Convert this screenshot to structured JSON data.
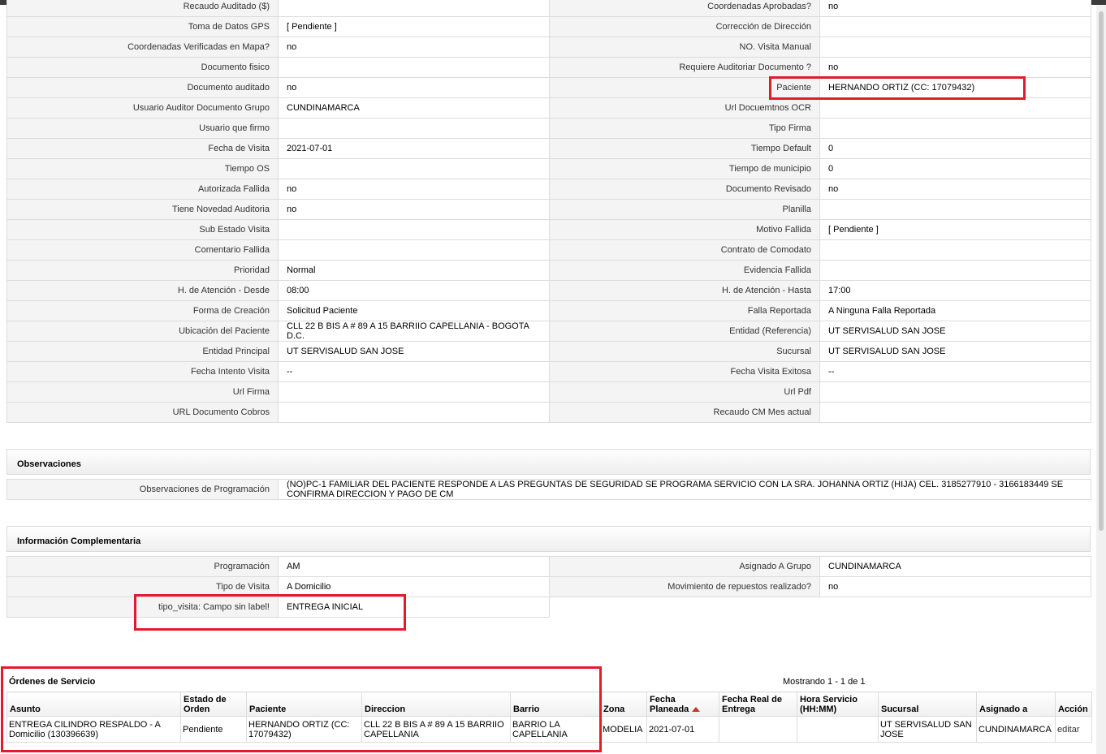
{
  "main_fields": [
    [
      "Recaudo Auditado ($)",
      "",
      "Coordenadas Aprobadas?",
      "no"
    ],
    [
      "Toma de Datos GPS",
      "[ Pendiente ]",
      "Corrección de Dirección",
      ""
    ],
    [
      "Coordenadas Verificadas en Mapa?",
      "no",
      "NO. Visita Manual",
      ""
    ],
    [
      "Documento fisico",
      "",
      "Requiere Auditoriar Documento ?",
      "no"
    ],
    [
      "Documento auditado",
      "no",
      "Paciente",
      "HERNANDO ORTIZ (CC: 17079432)"
    ],
    [
      "Usuario Auditor Documento Grupo",
      "CUNDINAMARCA",
      "Url Docuemtnos OCR",
      ""
    ],
    [
      "Usuario que firmo",
      "",
      "Tipo Firma",
      ""
    ],
    [
      "Fecha de Visita",
      "2021-07-01",
      "Tiempo Default",
      "0"
    ],
    [
      "Tiempo OS",
      "",
      "Tiempo de municipio",
      "0"
    ],
    [
      "Autorizada Fallida",
      "no",
      "Documento Revisado",
      "no"
    ],
    [
      "Tiene Novedad Auditoria",
      "no",
      "Planilla",
      ""
    ],
    [
      "Sub Estado Visita",
      "",
      "Motivo Fallida",
      "[ Pendiente ]"
    ],
    [
      "Comentario Fallida",
      "",
      "Contrato de Comodato",
      ""
    ],
    [
      "Prioridad",
      "Normal",
      "Evidencia Fallida",
      ""
    ],
    [
      "H. de Atención - Desde",
      "08:00",
      "H. de Atención - Hasta",
      "17:00"
    ],
    [
      "Forma de Creación",
      "Solicitud Paciente",
      "Falla Reportada",
      "A Ninguna Falla Reportada"
    ],
    [
      "Ubicación del Paciente",
      "CLL 22 B BIS A # 89 A 15 BARRIIO CAPELLANIA - BOGOTA D.C.",
      "Entidad (Referencia)",
      "UT SERVISALUD SAN JOSE"
    ],
    [
      "Entidad Principal",
      "UT SERVISALUD SAN JOSE",
      "Sucursal",
      "UT SERVISALUD SAN JOSE"
    ],
    [
      "Fecha Intento Visita",
      "--",
      "Fecha Visita Exitosa",
      "--"
    ],
    [
      "Url Firma",
      "",
      "Url Pdf",
      ""
    ],
    [
      "URL Documento Cobros",
      "",
      "Recaudo CM Mes actual",
      ""
    ]
  ],
  "observaciones": {
    "title": "Observaciones",
    "label": "Observaciones de Programación",
    "value": "(NO)PC-1 FAMILIAR DEL PACIENTE RESPONDE A LAS PREGUNTAS DE SEGURIDAD SE PROGRAMA SERVICIO CON LA SRA. JOHANNA ORTIZ (HIJA) CEL. 3185277910 - 3166183449 SE CONFIRMA DIRECCION Y PAGO DE CM"
  },
  "complementaria": {
    "title": "Información Complementaria",
    "rows": [
      [
        "Programación",
        "AM",
        "Asignado A Grupo",
        "CUNDINAMARCA"
      ],
      [
        "Tipo de Visita",
        "A Domicilio",
        "Movimiento de repuestos realizado?",
        "no"
      ]
    ],
    "extra": {
      "label": "tipo_visita: Campo sin label!",
      "value": "ENTREGA INICIAL"
    }
  },
  "ordenes": {
    "title": "Órdenes de Servicio",
    "showing": "Mostrando 1 - 1 de 1",
    "columns": [
      "Asunto",
      "Estado de Orden",
      "Paciente",
      "Direccion",
      "Barrio",
      "Zona",
      "Fecha Planeada",
      "Fecha Real de Entrega",
      "Hora Servicio (HH:MM)",
      "Sucursal",
      "Asignado a",
      "Acción"
    ],
    "rows": [
      [
        "ENTREGA CILINDRO RESPALDO - A Domicilio (130396639)",
        "Pendiente",
        "HERNANDO ORTIZ (CC: 17079432)",
        "CLL 22 B BIS A # 89 A 15 BARRIIO CAPELLANIA",
        "BARRIO LA CAPELLANIA",
        "MODELIA",
        "2021-07-01",
        "",
        "",
        "UT SERVISALUD SAN JOSE",
        "CUNDINAMARCA",
        "editar"
      ]
    ]
  },
  "colors": {
    "highlight": "#e21b2c",
    "label_bg": "#f4f4f4",
    "border": "#dcdcdc"
  }
}
